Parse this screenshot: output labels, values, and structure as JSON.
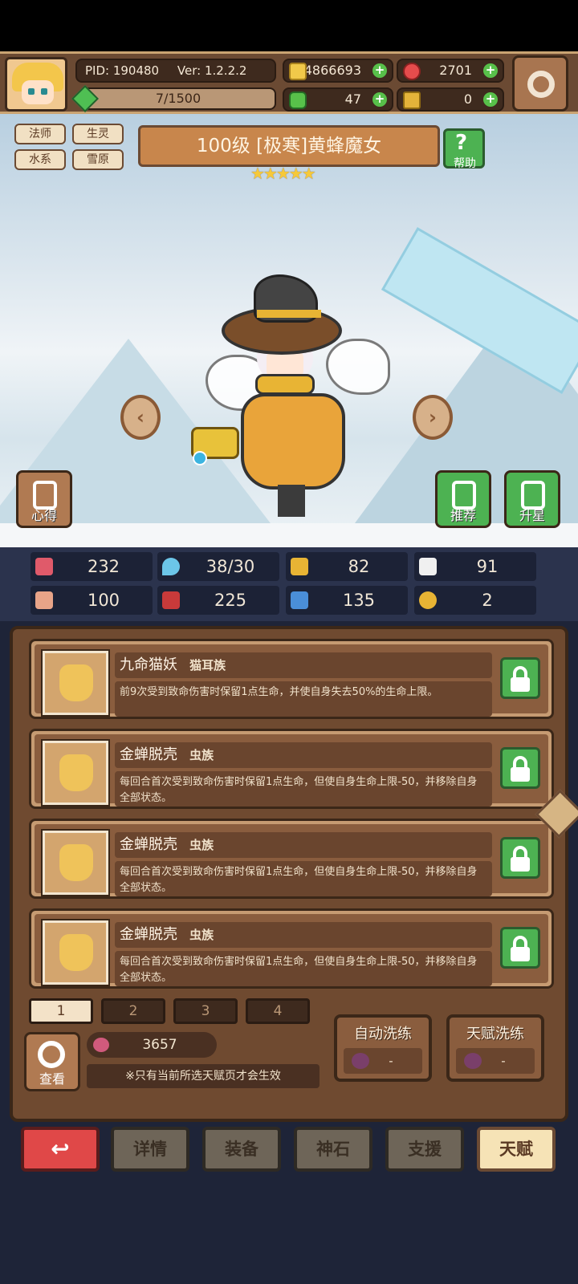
{
  "header": {
    "pid": "PID: 190480",
    "version": "Ver: 1.2.2.2",
    "exp": "7/1500",
    "gold": "4866693",
    "gems": "2701",
    "clovers": "47",
    "keys": "0"
  },
  "hero": {
    "tags": [
      "法师",
      "生灵",
      "水系",
      "雪原"
    ],
    "title": "100级 [极寒]黄蜂魔女",
    "stars": "★★★★★",
    "help_label": "帮助",
    "left_btn": "心得",
    "recommend_btn": "推荐",
    "upgrade_star_btn": "升星"
  },
  "stats": {
    "hp": "232",
    "mana": "38/30",
    "defense": "82",
    "speed": "91",
    "attack": "100",
    "magic": "225",
    "boots": "135",
    "luck": "2"
  },
  "talents": [
    {
      "name": "九命猫妖",
      "race": "猫耳族",
      "desc": "前9次受到致命伤害时保留1点生命，并使自身失去50%的生命上限。"
    },
    {
      "name": "金蝉脱壳",
      "race": "虫族",
      "desc": "每回合首次受到致命伤害时保留1点生命，但使自身生命上限-50，并移除自身全部状态。"
    },
    {
      "name": "金蝉脱壳",
      "race": "虫族",
      "desc": "每回合首次受到致命伤害时保留1点生命，但使自身生命上限-50，并移除自身全部状态。"
    },
    {
      "name": "金蝉脱壳",
      "race": "虫族",
      "desc": "每回合首次受到致命伤害时保留1点生命，但使自身生命上限-50，并移除自身全部状态。"
    }
  ],
  "pages": [
    "1",
    "2",
    "3",
    "4"
  ],
  "bottom_panel": {
    "view_label": "查看",
    "essence": "3657",
    "note": "※只有当前所选天赋页才会生效",
    "auto_wash": "自动洗练",
    "auto_wash_cost": "-",
    "talent_wash": "天赋洗练",
    "talent_wash_cost": "-"
  },
  "nav": {
    "back_icon": "↩",
    "details": "详情",
    "equipment": "装备",
    "godstone": "神石",
    "support": "支援",
    "talent": "天赋"
  },
  "colors": {
    "brown_frame": "#6f4a30",
    "green_button": "#4db252",
    "red_button": "#e04848",
    "stat_bg": "#1c2236"
  },
  "icons": [
    "settings-gear-icon",
    "gold-coin-icon",
    "red-gem-icon",
    "clover-icon",
    "key-icon",
    "lock-icon",
    "magnifier-icon",
    "back-arrow-icon",
    "heart-icon",
    "droplet-icon",
    "shield-icon",
    "wing-icon",
    "fist-icon",
    "book-icon",
    "boot-icon",
    "horseshoe-icon"
  ]
}
